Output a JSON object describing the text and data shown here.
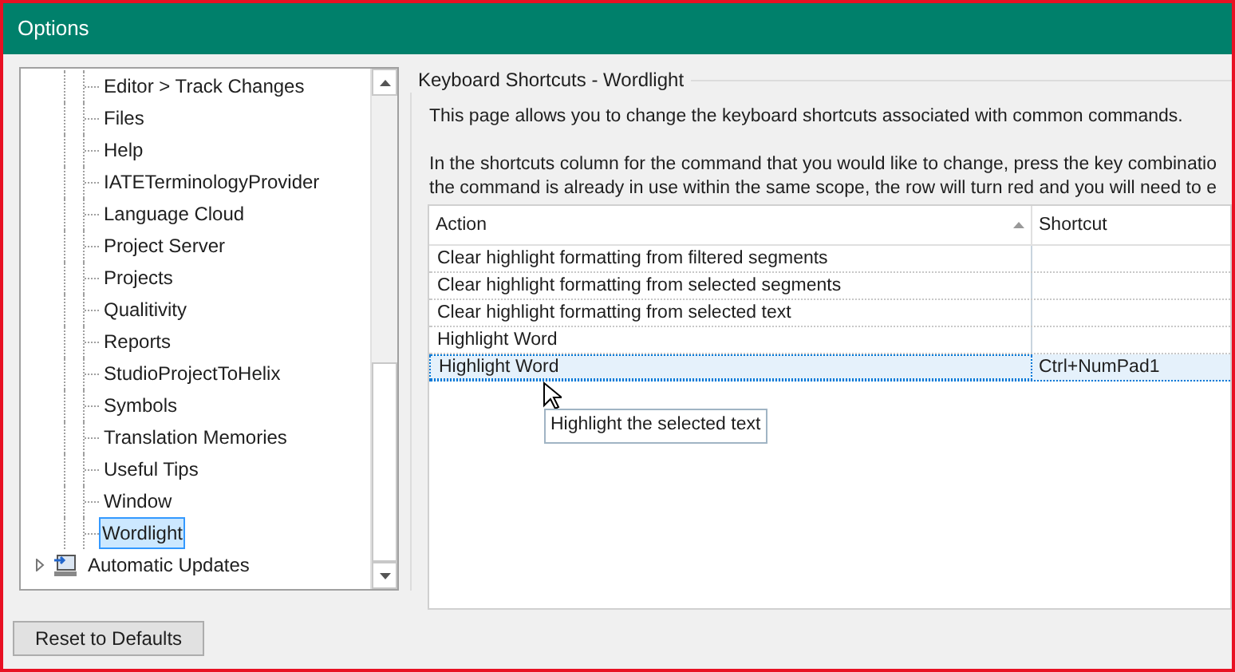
{
  "window": {
    "title": "Options"
  },
  "tree": {
    "items": [
      {
        "label": "Editor > Track Changes",
        "kind": "leaf",
        "selected": false
      },
      {
        "label": "Files",
        "kind": "leaf",
        "selected": false
      },
      {
        "label": "Help",
        "kind": "leaf",
        "selected": false
      },
      {
        "label": "IATETerminologyProvider",
        "kind": "leaf",
        "selected": false
      },
      {
        "label": "Language Cloud",
        "kind": "leaf",
        "selected": false
      },
      {
        "label": "Project Server",
        "kind": "leaf",
        "selected": false
      },
      {
        "label": "Projects",
        "kind": "leaf",
        "selected": false
      },
      {
        "label": "Qualitivity",
        "kind": "leaf",
        "selected": false
      },
      {
        "label": "Reports",
        "kind": "leaf",
        "selected": false
      },
      {
        "label": "StudioProjectToHelix",
        "kind": "leaf",
        "selected": false
      },
      {
        "label": "Symbols",
        "kind": "leaf",
        "selected": false
      },
      {
        "label": "Translation Memories",
        "kind": "leaf",
        "selected": false
      },
      {
        "label": "Useful Tips",
        "kind": "leaf",
        "selected": false
      },
      {
        "label": "Window",
        "kind": "leaf",
        "selected": false
      },
      {
        "label": "Wordlight",
        "kind": "leaf",
        "selected": true
      },
      {
        "label": "Automatic Updates",
        "kind": "group",
        "selected": false,
        "expanded": false
      }
    ]
  },
  "panel": {
    "title": "Keyboard Shortcuts - Wordlight",
    "intro": "This page allows you to change the keyboard shortcuts associated with common commands.",
    "instructions": [
      "In the shortcuts column for the command that you would like to change, press the key combinatio",
      "the command is already in use within the same scope, the row will turn red and you will need to e"
    ],
    "table": {
      "columns": [
        "Action",
        "Shortcut"
      ],
      "rows": [
        {
          "action": "Clear highlight formatting from filtered segments",
          "shortcut": "",
          "selected": false
        },
        {
          "action": "Clear highlight formatting from selected segments",
          "shortcut": "",
          "selected": false
        },
        {
          "action": "Clear highlight formatting from selected text",
          "shortcut": "",
          "selected": false
        },
        {
          "action": "Highlight Word",
          "shortcut": "",
          "selected": false
        },
        {
          "action": "Highlight Word",
          "shortcut": "Ctrl+NumPad1",
          "selected": true
        }
      ],
      "tooltip": "Highlight the selected text"
    }
  },
  "buttons": [
    "Reset to Defaults"
  ]
}
